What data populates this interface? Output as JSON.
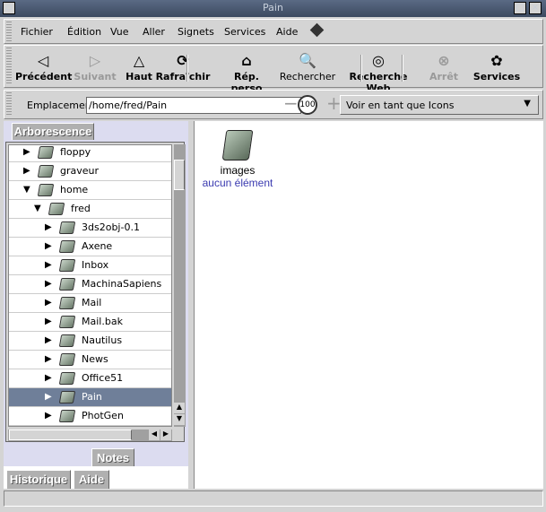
{
  "window": {
    "title": "Pain"
  },
  "menu": [
    {
      "label": "Fichier"
    },
    {
      "label": "Édition"
    },
    {
      "label": "Vue"
    },
    {
      "label": "Aller"
    },
    {
      "label": "Signets"
    },
    {
      "label": "Services"
    },
    {
      "label": "Aide"
    }
  ],
  "toolbar": [
    {
      "label": "Précédent",
      "icon": "back-arrow-icon",
      "enabled": true
    },
    {
      "label": "Suivant",
      "icon": "forward-arrow-icon",
      "enabled": false
    },
    {
      "label": "Haut",
      "icon": "up-arrow-icon",
      "enabled": true
    },
    {
      "label": "Rafraîchir",
      "icon": "refresh-icon",
      "enabled": true
    },
    {
      "label": "Rép. perso",
      "icon": "home-icon",
      "enabled": true
    },
    {
      "label": "Rechercher",
      "icon": "search-icon",
      "enabled": true
    },
    {
      "label": "Recherche Web",
      "icon": "web-search-icon",
      "enabled": true
    },
    {
      "label": "Arrêt",
      "icon": "stop-icon",
      "enabled": false
    },
    {
      "label": "Services",
      "icon": "services-icon",
      "enabled": true
    }
  ],
  "location": {
    "label": "Emplacement :",
    "value": "/home/fred/Pain",
    "zoom": "100",
    "view_mode": "Voir en tant que Icons"
  },
  "sidebar": {
    "tab": "Arborescence",
    "tree": [
      {
        "label": "floppy",
        "depth": 0,
        "expanded": false
      },
      {
        "label": "graveur",
        "depth": 0,
        "expanded": false
      },
      {
        "label": "home",
        "depth": 0,
        "expanded": true
      },
      {
        "label": "fred",
        "depth": 1,
        "expanded": true
      },
      {
        "label": "3ds2obj-0.1",
        "depth": 2,
        "expanded": false
      },
      {
        "label": "Axene",
        "depth": 2,
        "expanded": false
      },
      {
        "label": "Inbox",
        "depth": 2,
        "expanded": false
      },
      {
        "label": "MachinaSapiens",
        "depth": 2,
        "expanded": false
      },
      {
        "label": "Mail",
        "depth": 2,
        "expanded": false
      },
      {
        "label": "Mail.bak",
        "depth": 2,
        "expanded": false
      },
      {
        "label": "Nautilus",
        "depth": 2,
        "expanded": false
      },
      {
        "label": "News",
        "depth": 2,
        "expanded": false
      },
      {
        "label": "Office51",
        "depth": 2,
        "expanded": false
      },
      {
        "label": "Pain",
        "depth": 2,
        "expanded": false,
        "selected": true
      },
      {
        "label": "PhotGen",
        "depth": 2,
        "expanded": false
      }
    ],
    "bottom_tabs": {
      "notes": "Notes",
      "history": "Historique",
      "help": "Aide"
    }
  },
  "content": {
    "items": [
      {
        "name": "images",
        "info": "aucun élément"
      }
    ]
  }
}
